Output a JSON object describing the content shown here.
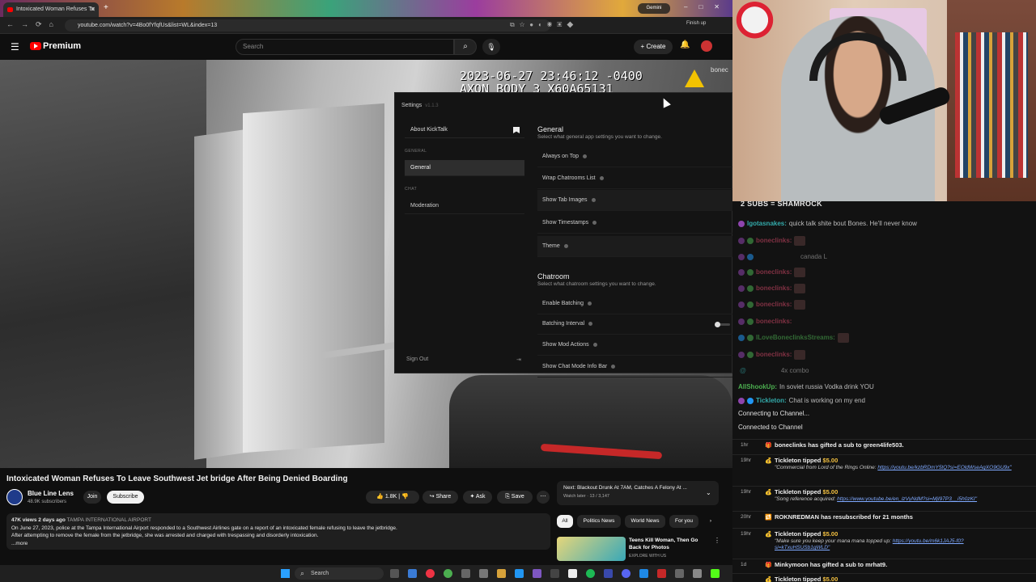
{
  "browser": {
    "tab_title": "Intoxicated Woman Refuses To",
    "gemini_label": "Gemini",
    "url": "youtube.com/watch?v=4Bo0fYfqfUs&list=WL&index=13",
    "finish_label": "Finish up"
  },
  "youtube": {
    "premium_label": "Premium",
    "search_placeholder": "Search",
    "create_label": "+ Create"
  },
  "video_overlay": {
    "timestamp": "2023-06-27 23:46:12 -0400",
    "device": "AXON BODY 3 X60A65131",
    "corner_tag": "bonec"
  },
  "settings": {
    "title": "Settings",
    "version": "v1.1.3",
    "about_label": "About KickTalk",
    "section_general": "GENERAL",
    "item_general": "General",
    "section_chat": "CHAT",
    "item_moderation": "Moderation",
    "sign_out": "Sign Out",
    "general_heading": "General",
    "general_desc": "Select what general app settings you want to change.",
    "general_options": [
      "Always on Top",
      "Wrap Chatrooms List",
      "Show Tab Images",
      "Show Timestamps",
      "Theme"
    ],
    "chatroom_heading": "Chatroom",
    "chatroom_desc": "Select what chatroom settings you want to change.",
    "chatroom_options": [
      "Enable Batching",
      "Batching Interval",
      "Show Mod Actions",
      "Show Chat Mode Info Bar"
    ]
  },
  "video": {
    "title": "Intoxicated Woman Refuses To Leave Southwest Jet bridge After Being Denied Boarding",
    "channel": "Blue Line Lens",
    "subscribers": "48.9K subscribers",
    "join": "Join",
    "subscribe": "Subscribe",
    "likes": "1.8K",
    "share": "Share",
    "ask": "Ask",
    "save": "Save",
    "views_date": "47K views  2 days ago",
    "location": "TAMPA INTERNATIONAL AIRPORT",
    "description_1": "On June 27, 2023, police at the Tampa International Airport responded to a Southwest Airlines gate on a report of an intoxicated female refusing to leave the jetbridge.",
    "description_2": "After attempting to remove the female from the jetbridge, she was arrested and charged with trespassing and disorderly intoxication.",
    "more": "...more"
  },
  "next_up": {
    "label": "Next: Blackout Drunk At 7AM, Catches A Felony At ...",
    "watch_later": "Watch later · 13 / 3,147"
  },
  "chips": [
    "All",
    "Politics News",
    "World News",
    "For you"
  ],
  "recommendation": {
    "title": "Teens Kill Woman, Then Go Back for Photos",
    "channel": "EXPLORE WITH US"
  },
  "taskbar": {
    "search": "Search"
  },
  "chat": {
    "goal_text": "2 SUBS = SHAMROCK",
    "messages": [
      {
        "user": "lgotasnakes:",
        "text": "quick talk shite bout Bones. He'll never know"
      },
      {
        "user": "boneclinks:",
        "text": ""
      },
      {
        "user": "",
        "text": "canada L"
      },
      {
        "user": "boneclinks:",
        "text": ""
      },
      {
        "user": "boneclinks:",
        "text": ""
      },
      {
        "user": "boneclinks:",
        "text": ""
      },
      {
        "user": "boneclinks:",
        "text": ""
      },
      {
        "user": "ILoveBonecIinksStreams:",
        "text": ""
      },
      {
        "user": "boneclinks:",
        "text": ""
      },
      {
        "user": "",
        "text": "4x  combo"
      },
      {
        "user": "AllShookUp:",
        "text": "In soviet russia Vodka drink YOU"
      },
      {
        "user": "Tickleton:",
        "text": "Chat is working on my end"
      }
    ],
    "system_1": "Connecting to Channel...",
    "system_2": "Connected to Channel",
    "events": [
      {
        "ago": "1hr",
        "text": "boneclinks has gifted a sub to green4life503.",
        "sub": "",
        "link": ""
      },
      {
        "ago": "19hr",
        "text": "Tickleton tipped",
        "amount": "$5.00",
        "sub": "\"Commercial from Lord of the Rings Online:",
        "link": "https://youtu.be/kzbRDmY5tQ?si=EOldWseAqXO9GU9x\""
      },
      {
        "ago": "19hr",
        "text": "Tickleton tipped",
        "amount": "$5.00",
        "sub": "\"Song reference acquired:",
        "link": "https://www.youtube.be/en_lzVyNdM?si=MjI97P3__i5h0zKI\""
      },
      {
        "ago": "20hr",
        "text": "ROKNREDMAN has resubscribed for 21 months",
        "sub": "",
        "link": ""
      },
      {
        "ago": "19hr",
        "text": "Tickleton tipped",
        "amount": "$5.00",
        "sub": "\"Make sure you keep your mana mana topped up:",
        "link": "https://youtu.be/m6k1JAJ5-f0?si=kTxuHSUSb1gWLD\""
      },
      {
        "ago": "1d",
        "text": "Minkymoon has gifted a sub to mrhat9.",
        "sub": "",
        "link": ""
      },
      {
        "ago": "",
        "text": "Tickleton tipped",
        "amount": "$5.00",
        "sub": "",
        "link": ""
      }
    ]
  }
}
